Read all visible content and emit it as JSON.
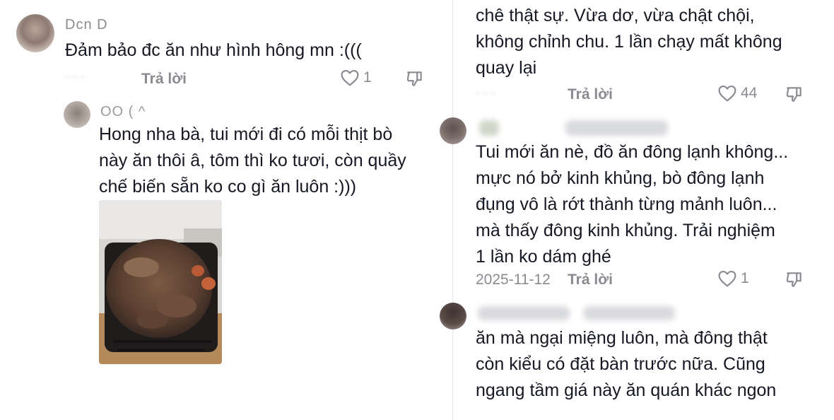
{
  "comments": [
    {
      "username": "Dcn D",
      "text_lines": [
        "Đảm bảo đc ăn như hình hông mn :((("
      ],
      "reply_label": "Trả lời",
      "likes": "1"
    },
    {
      "username": "OO ( ^",
      "text_lines": [
        "Hong nha bà, tui mới đi có mỗi thịt bò",
        "này ăn thôi â, tôm thì ko tươi, còn quầy",
        "chế biến sẵn ko co gì ăn luôn :)))"
      ],
      "image": "grilled-meat-photo"
    },
    {
      "text_lines": [
        "chê thật sự. Vừa dơ, vừa chật chội,",
        "không chỉnh chu. 1 lần chạy mất không",
        "quay lại"
      ],
      "reply_label": "Trả lời",
      "likes": "44"
    },
    {
      "text_lines": [
        "Tui mới ăn nè, đồ ăn đông lạnh không...",
        "mực nó bở kinh khủng, bò đông lạnh",
        "đụng vô là rớt thành từng mảnh luôn...",
        "mà thấy đông kinh khủng. Trải nghiệm",
        "1 lần ko dám ghé"
      ],
      "date": "2025-11-12",
      "reply_label": "Trả lời",
      "likes": "1"
    },
    {
      "text_lines": [
        "ăn mà ngại miệng luôn, mà đông thật",
        "còn kiểu có đặt bàn trước nữa. Cũng",
        "ngang tầm giá này ăn quán khác ngon"
      ]
    }
  ],
  "icons": {
    "like": "heart-outline-icon",
    "dislike": "thumbs-down-icon"
  },
  "colors": {
    "text": "#161823",
    "muted": "#8a8b91",
    "divider": "#e6e6e8"
  }
}
